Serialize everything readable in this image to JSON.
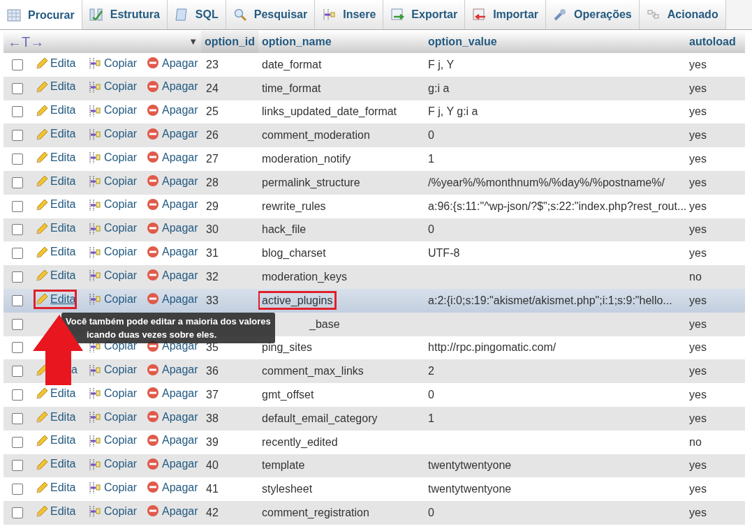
{
  "tabs": [
    {
      "label": "Procurar",
      "selected": true
    },
    {
      "label": "Estrutura",
      "selected": false
    },
    {
      "label": "SQL",
      "selected": false
    },
    {
      "label": "Pesquisar",
      "selected": false
    },
    {
      "label": "Insere",
      "selected": false
    },
    {
      "label": "Exportar",
      "selected": false
    },
    {
      "label": "Importar",
      "selected": false
    },
    {
      "label": "Operações",
      "selected": false
    },
    {
      "label": "Acionado",
      "selected": false
    }
  ],
  "table": {
    "resize_label": "←T→",
    "sort_mark": "▼",
    "columns": [
      "option_id",
      "option_name",
      "option_value",
      "autoload"
    ],
    "rows": [
      {
        "edit": "Edita",
        "copy": "Copiar",
        "delete": "Apagar",
        "option_id": "23",
        "option_name": "date_format",
        "option_value": "F j, Y",
        "autoload": "yes",
        "highlighted": false
      },
      {
        "edit": "Edita",
        "copy": "Copiar",
        "delete": "Apagar",
        "option_id": "24",
        "option_name": "time_format",
        "option_value": "g:i a",
        "autoload": "yes",
        "highlighted": false
      },
      {
        "edit": "Edita",
        "copy": "Copiar",
        "delete": "Apagar",
        "option_id": "25",
        "option_name": "links_updated_date_format",
        "option_value": "F j, Y g:i a",
        "autoload": "yes",
        "highlighted": false
      },
      {
        "edit": "Edita",
        "copy": "Copiar",
        "delete": "Apagar",
        "option_id": "26",
        "option_name": "comment_moderation",
        "option_value": "0",
        "autoload": "yes",
        "highlighted": false
      },
      {
        "edit": "Edita",
        "copy": "Copiar",
        "delete": "Apagar",
        "option_id": "27",
        "option_name": "moderation_notify",
        "option_value": "1",
        "autoload": "yes",
        "highlighted": false
      },
      {
        "edit": "Edita",
        "copy": "Copiar",
        "delete": "Apagar",
        "option_id": "28",
        "option_name": "permalink_structure",
        "option_value": "/%year%/%monthnum%/%day%/%postname%/",
        "autoload": "yes",
        "highlighted": false
      },
      {
        "edit": "Edita",
        "copy": "Copiar",
        "delete": "Apagar",
        "option_id": "29",
        "option_name": "rewrite_rules",
        "option_value": "a:96:{s:11:\"^wp-json/?$\";s:22:\"index.php?rest_rout...",
        "autoload": "yes",
        "highlighted": false
      },
      {
        "edit": "Edita",
        "copy": "Copiar",
        "delete": "Apagar",
        "option_id": "30",
        "option_name": "hack_file",
        "option_value": "0",
        "autoload": "yes",
        "highlighted": false
      },
      {
        "edit": "Edita",
        "copy": "Copiar",
        "delete": "Apagar",
        "option_id": "31",
        "option_name": "blog_charset",
        "option_value": "UTF-8",
        "autoload": "yes",
        "highlighted": false
      },
      {
        "edit": "Edita",
        "copy": "Copiar",
        "delete": "Apagar",
        "option_id": "32",
        "option_name": "moderation_keys",
        "autoload": "no",
        "highlighted": false
      },
      {
        "edit": "Edita",
        "copy": "Copiar",
        "delete": "Apagar",
        "option_id": "33",
        "option_name": "active_plugins",
        "option_value": "a:2:{i:0;s:19:\"akismet/akismet.php\";i:1;s:9:\"hello...",
        "autoload": "yes",
        "highlighted": true,
        "annotated": true
      },
      {
        "option_name": "_base",
        "autoload": "yes",
        "highlighted": false
      },
      {
        "copy": "Copiar",
        "delete": "Apagar",
        "option_id": "35",
        "option_name": "ping_sites",
        "option_value": "http://rpc.pingomatic.com/",
        "autoload": "yes",
        "highlighted": false
      },
      {
        "edit": "a",
        "copy": "Copiar",
        "delete": "Apagar",
        "option_id": "36",
        "option_name": "comment_max_links",
        "option_value": "2",
        "autoload": "yes",
        "highlighted": false
      },
      {
        "edit": "Edita",
        "copy": "Copiar",
        "delete": "Apagar",
        "option_id": "37",
        "option_name": "gmt_offset",
        "option_value": "0",
        "autoload": "yes",
        "highlighted": false
      },
      {
        "edit": "Edita",
        "copy": "Copiar",
        "delete": "Apagar",
        "option_id": "38",
        "option_name": "default_email_category",
        "option_value": "1",
        "autoload": "yes",
        "highlighted": false
      },
      {
        "edit": "Edita",
        "copy": "Copiar",
        "delete": "Apagar",
        "option_id": "39",
        "option_name": "recently_edited",
        "autoload": "no",
        "highlighted": false
      },
      {
        "edit": "Edita",
        "copy": "Copiar",
        "delete": "Apagar",
        "option_id": "40",
        "option_name": "template",
        "option_value": "twentytwentyone",
        "autoload": "yes",
        "highlighted": false
      },
      {
        "edit": "Edita",
        "copy": "Copiar",
        "delete": "Apagar",
        "option_id": "41",
        "option_name": "stylesheet",
        "option_value": "twentytwentyone",
        "autoload": "yes",
        "highlighted": false
      },
      {
        "edit": "Edita",
        "copy": "Copiar",
        "delete": "Apagar",
        "option_id": "42",
        "option_name": "comment_registration",
        "option_value": "0",
        "autoload": "yes",
        "highlighted": false
      }
    ]
  },
  "tooltip": {
    "lines": [
      "Você também pode editar a maioria dos valores",
      "icando duas vezes sobre eles."
    ]
  }
}
